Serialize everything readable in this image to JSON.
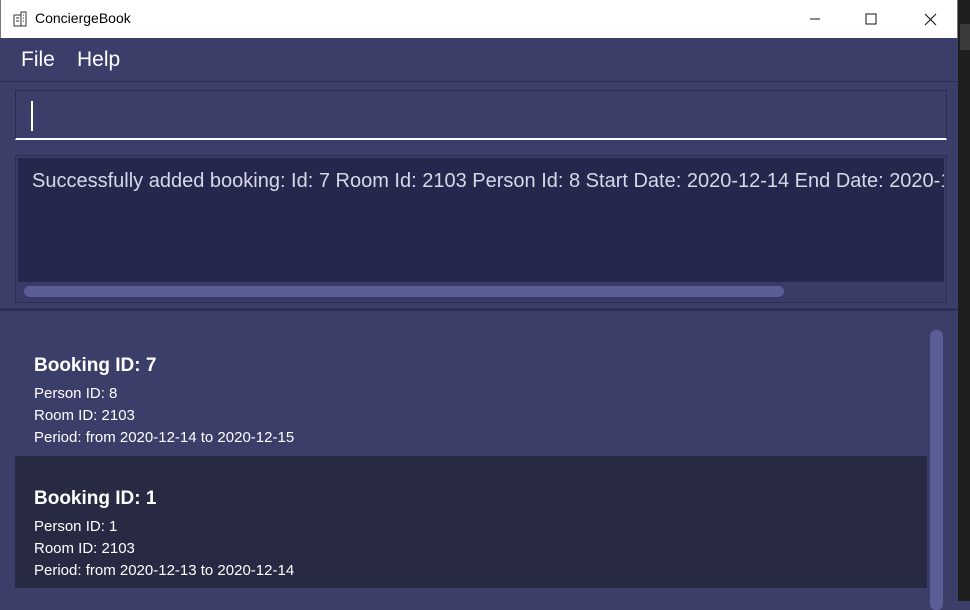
{
  "window": {
    "title": "ConciergeBook",
    "controls": [
      "minimize-icon",
      "maximize-icon",
      "close-icon"
    ]
  },
  "menu": {
    "file": "File",
    "help": "Help"
  },
  "command": {
    "value": "",
    "placeholder": ""
  },
  "result": {
    "text": "Successfully added booking: Id: 7 Room Id: 2103 Person Id: 8 Start Date: 2020-12-14 End Date: 2020-1"
  },
  "bookings": [
    {
      "title": "Booking ID: 7",
      "person": "Person ID: 8",
      "room": "Room ID: 2103",
      "period": "Period: from 2020-12-14 to 2020-12-15"
    },
    {
      "title": "Booking ID: 1",
      "person": "Person ID: 1",
      "room": "Room ID: 2103",
      "period": "Period: from 2020-12-13 to 2020-12-14"
    }
  ],
  "colors": {
    "background": "#3c3e6a",
    "result_background": "#25274d",
    "selected_card": "#272a42",
    "scroll_thumb": "#5a5d96"
  }
}
